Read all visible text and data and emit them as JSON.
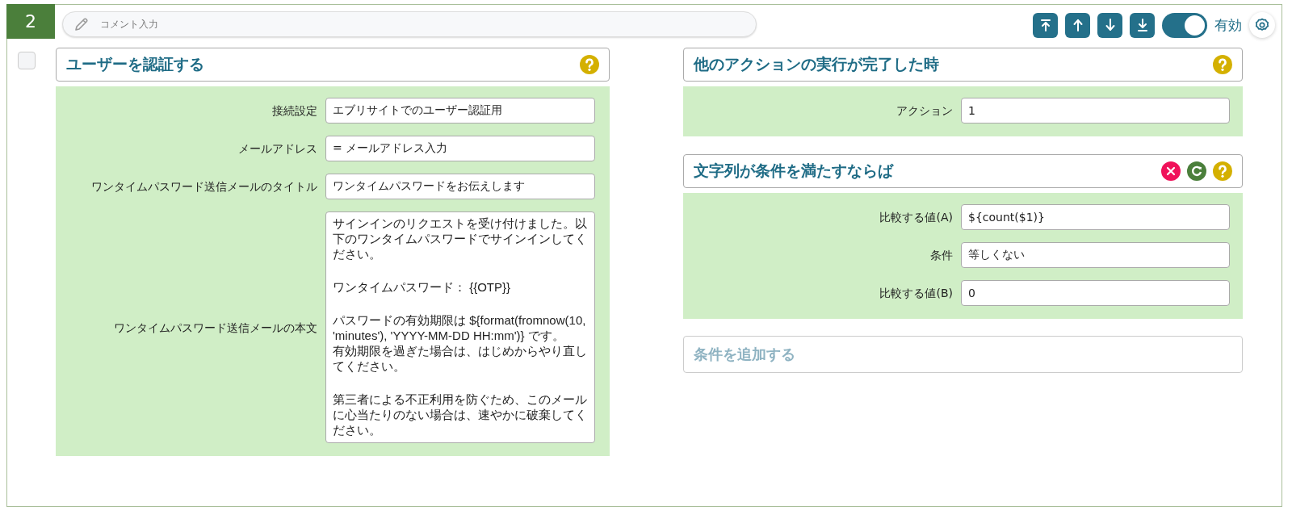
{
  "step": {
    "number": "2"
  },
  "comment": {
    "placeholder": "コメント入力"
  },
  "toolbar": {
    "buttons": [
      {
        "kind": "top"
      },
      {
        "kind": "up"
      },
      {
        "kind": "down"
      },
      {
        "kind": "bottom"
      }
    ],
    "enabled": true,
    "enabled_label": "有効"
  },
  "select_checkbox": {
    "checked": false
  },
  "left_card": {
    "title": "ユーザーを認証する",
    "actions": [
      {
        "kind": "help"
      }
    ],
    "fields": [
      {
        "label": "接続設定",
        "value": "エブリサイトでのユーザー認証用",
        "kind": "input"
      },
      {
        "label": "メールアドレス",
        "value": "= メールアドレス入力",
        "kind": "input"
      },
      {
        "label": "ワンタイムパスワード送信メールのタイトル",
        "value": "ワンタイムパスワードをお伝えします",
        "kind": "input"
      },
      {
        "label": "ワンタイムパスワード送信メールの本文",
        "kind": "textarea",
        "paragraphs": [
          [
            "サインインのリクエストを受け付けました。以下のワンタイムパスワードでサインインしてください。"
          ],
          [
            "ワンタイムパスワード： {{OTP}}"
          ],
          [
            "パスワードの有効期限は ${format(fromnow(10, 'minutes'), 'YYYY-MM-DD HH:mm')} です。",
            "有効期限を過ぎた場合は、はじめからやり直してください。"
          ],
          [
            "第三者による不正利用を防ぐため、このメールに心当たりのない場合は、速やかに破棄してください。"
          ]
        ]
      }
    ]
  },
  "right_cards": [
    {
      "title": "他のアクションの実行が完了した時",
      "actions": [
        {
          "kind": "help"
        }
      ],
      "fields": [
        {
          "label": "アクション",
          "value": "1",
          "kind": "input"
        }
      ]
    },
    {
      "title": "文字列が条件を満たすならば",
      "actions": [
        {
          "kind": "delete"
        },
        {
          "kind": "refresh"
        },
        {
          "kind": "help"
        }
      ],
      "fields": [
        {
          "label": "比較する値(A)",
          "value": "${count($1)}",
          "kind": "input"
        },
        {
          "label": "条件",
          "value": "等しくない",
          "kind": "input"
        },
        {
          "label": "比較する値(B)",
          "value": "0",
          "kind": "input"
        }
      ]
    }
  ],
  "add_condition": {
    "label": "条件を追加する"
  }
}
